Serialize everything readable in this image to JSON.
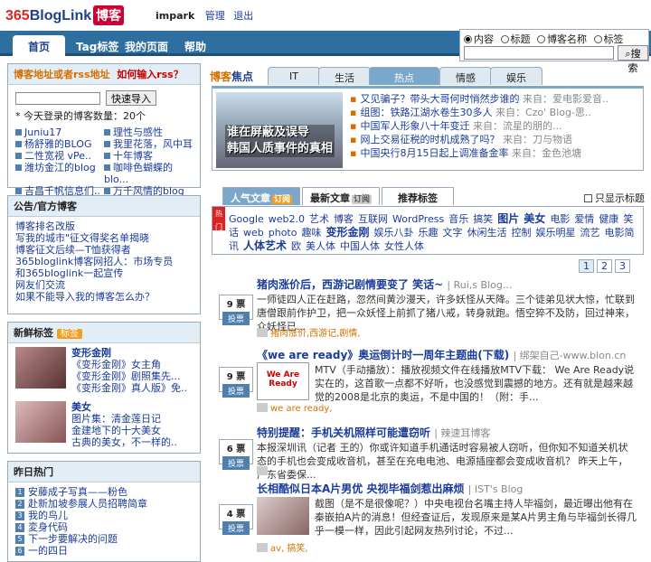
{
  "header": {
    "logo_num": "365",
    "logo_text": "BlogLink",
    "logo_cn": "博客",
    "user": "impark",
    "manage": "管理",
    "logout": "退出"
  },
  "nav": {
    "tabs": [
      "首页",
      "Tag标签",
      "我的页面",
      "帮助"
    ]
  },
  "search": {
    "options": [
      "内容",
      "标题",
      "博客名称",
      "标签"
    ],
    "button": "搜索"
  },
  "left": {
    "rss": {
      "title_a": "博客地址或者rss地址",
      "title_b": "如何输入rss？",
      "button": "快速导入",
      "count_label": "今天登录的博客数量：",
      "count": "20个",
      "items": [
        "Juniu17",
        "理性与感性",
        "杨舒雅的BLOG",
        "我里花落，风中耳",
        "二性宽视 vPe..",
        "十年博客",
        "潍坊金江的blog",
        "咖啡色蝴蝶的blo...",
        "吉昌千帆信息们..",
        "万千风情的blog"
      ]
    },
    "notice": {
      "title": "公告/官方博客",
      "items": [
        "博客排名改版",
        "写我的城市\"征文得奖名单揭晓",
        "博客征文后续—T恤获得者",
        "365bloglink博客网招人：市场专员",
        "和365bloglink一起宣传",
        "网友们交流",
        "如果不能导入我的博客怎么办？"
      ]
    },
    "newtags": {
      "title": "新鲜标签",
      "badge": "标签",
      "groups": [
        {
          "name": "变形金刚",
          "lines": [
            "《变形金刚》女主角",
            "《变形金刚》剧照集先...",
            "《变形金刚》真人版》免.."
          ]
        },
        {
          "name": "美女",
          "lines": [
            "图片集：清金莲日记",
            "金建地下的十大美女",
            "古典的美女，不一样的.."
          ]
        }
      ]
    },
    "yesterday": {
      "title": "昨日热门",
      "items": [
        "安藤成子写真——粉色",
        "赴新加坡参展人员招聘简章",
        "我的鸟儿",
        "変身代码",
        "下一步要解决的问题",
        "一的四日"
      ]
    }
  },
  "main": {
    "section_title_a": "博客",
    "section_title_b": "焦点",
    "tabs": [
      "IT",
      "生活",
      "热点",
      "情感",
      "娱乐"
    ],
    "feature_img_text": [
      "谁在屏蔽及误导",
      "韩国人质事件的真相"
    ],
    "feature_items": [
      {
        "t": "又见骗子？带头大哥何时悄然步谁的",
        "s": "来自：爱电影爱音.."
      },
      {
        "t": "组图：铁路江湖水卷生30多人",
        "s": "来自：Czo' Blog-思.."
      },
      {
        "t": "中国军人形象八十年变迁",
        "s": "来自：流星的朋的..."
      },
      {
        "t": "网上交易征税的时机成熟了吗？",
        "s": "来自：刀与物语"
      },
      {
        "t": "中国央行8月15日起上调准备金率",
        "s": "来自：金色池塘"
      }
    ],
    "subtabs": [
      {
        "label": "人气文章",
        "tag": "订阅"
      },
      {
        "label": "最新文章",
        "tag": "订阅"
      },
      {
        "label": "推荐标签",
        "tag": ""
      }
    ],
    "only_title": "只显示标题",
    "ribbon": "热门标签",
    "tagcloud": [
      {
        "t": "Google",
        "b": false
      },
      {
        "t": "web2.0",
        "b": false
      },
      {
        "t": "艺术",
        "b": false
      },
      {
        "t": "博客",
        "b": false
      },
      {
        "t": "互联网",
        "b": false
      },
      {
        "t": "WordPress",
        "b": false
      },
      {
        "t": "音乐",
        "b": false
      },
      {
        "t": "搞笑",
        "b": false
      },
      {
        "t": "图片",
        "b": true
      },
      {
        "t": "美女",
        "b": true
      },
      {
        "t": "电影",
        "b": false
      },
      {
        "t": "爱情",
        "b": false
      },
      {
        "t": "健康",
        "b": false
      },
      {
        "t": "笑话",
        "b": false
      },
      {
        "t": "web",
        "b": false
      },
      {
        "t": "photo",
        "b": false
      },
      {
        "t": "趣味",
        "b": false
      },
      {
        "t": "变形金刚",
        "b": true
      },
      {
        "t": "娱乐八卦",
        "b": false
      },
      {
        "t": "乐趣",
        "b": false
      },
      {
        "t": "文字",
        "b": false
      },
      {
        "t": "休闲生活",
        "b": false
      },
      {
        "t": "控制",
        "b": false
      },
      {
        "t": "娱乐明星",
        "b": false
      },
      {
        "t": "流艺",
        "b": false
      },
      {
        "t": "电影简讯",
        "b": false
      },
      {
        "t": "人体艺术",
        "b": true
      },
      {
        "t": "欧",
        "b": false
      },
      {
        "t": "美人体",
        "b": false
      },
      {
        "t": "中国人体",
        "b": false
      },
      {
        "t": "女性人体",
        "b": false
      }
    ],
    "pages": [
      "1",
      "2",
      "3"
    ],
    "vote_label": "投票",
    "posts": [
      {
        "votes": "9 票",
        "title": "猪肉涨价后，西游记剧情要变了 笑话~",
        "src": "| Rui,s Blog...",
        "text": "一师徒四人正在赶路，忽然间黄沙漫天，许多妖怪从天降。三个徒弟见状大惊，忙联到唐僧跟前作护卫，把一众妖怪上前抓了猪八戒，转身就跑。悟空猝不及防，回过神来，众妖怪已...",
        "tags": "猪肉涨价,西游记,剧情,"
      },
      {
        "votes": "9 票",
        "title": "《we are ready》奥运倒计时一周年主题曲(下载)",
        "src": "| 绑架自己-www.blon.cn",
        "img": "We Are Ready",
        "text": "MTV（手动播放）：播放视频文件在线播放MTV下载： We Are Ready说实在的，这首歌一点都不好听，也没感觉到震撼的地方。还有就是越来越觉的2008是北京的奥运，不是中国的！（附：手...",
        "tags": "we are ready,"
      },
      {
        "votes": "6 票",
        "title": "特别提醒：手机关机照样可能遭窃听",
        "src": "| 辣速耳博客",
        "text": "本报深圳讯（记者 王的）你或许知道手机通话时容易被人窃听，但你知不知道关机状态的手机也会变成收音机，甚至在充电电池、电源插座都会变成收音机？ 昨天上午，广东省委保...",
        "tags": ""
      },
      {
        "votes": "4 票",
        "title": "长相酷似日本A片男优 央视毕福剑惹出麻烦",
        "src": "| IST's Blog",
        "text": "截图（是不是很像呢？）中央电视台名嘴主持人毕福剑，最近曝出他有在秦嵌拍A片的消息！但经查证后，发现原来是某A片男主角与毕福剑长得几乎一模一样，因此引起网友热列讨论，不过...",
        "tags": "av, 搞笑,"
      }
    ]
  }
}
